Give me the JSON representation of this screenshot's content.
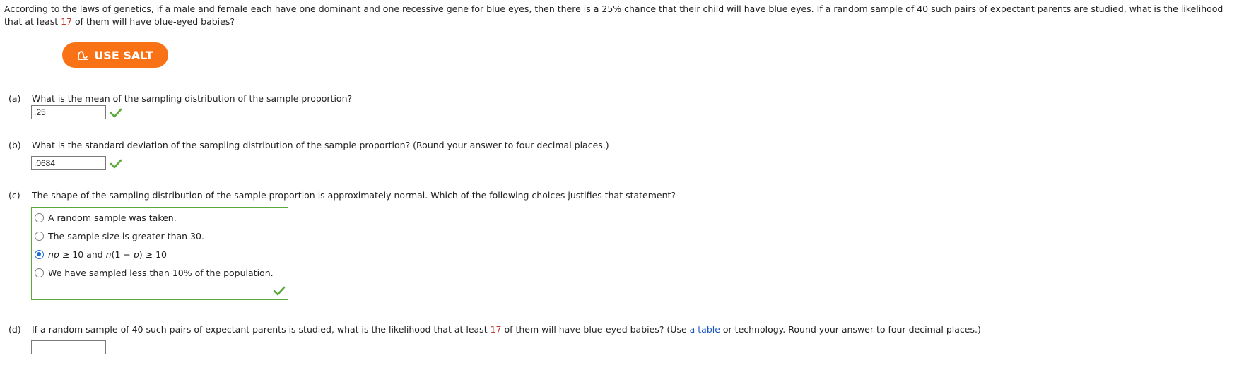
{
  "intro": {
    "text_before": "According to the laws of genetics, if a male and female each have one dominant and one recessive gene for blue eyes, then there is a 25% chance that their child will have blue eyes. If a random sample of 40 such pairs of expectant parents are studied, what is the likelihood that at least ",
    "highlight": "17",
    "text_after": " of them will have blue-eyed babies?"
  },
  "salt_button": {
    "label": "USE SALT"
  },
  "parts": {
    "a": {
      "letter": "(a)",
      "question": "What is the mean of the sampling distribution of the sample proportion?",
      "answer": ".25",
      "status": "correct"
    },
    "b": {
      "letter": "(b)",
      "question": "What is the standard deviation of the sampling distribution of the sample proportion? (Round your answer to four decimal places.)",
      "answer": ".0684",
      "status": "correct"
    },
    "c": {
      "letter": "(c)",
      "question": "The shape of the sampling distribution of the sample proportion is approximately normal. Which of the following choices justifies that statement?",
      "choices": [
        {
          "label": "A random sample was taken.",
          "selected": false
        },
        {
          "label": "The sample size is greater than 30.",
          "selected": false
        },
        {
          "label_parts": [
            "np",
            " ≥ 10 and ",
            "n",
            "(1 − ",
            "p",
            ") ≥ 10"
          ],
          "selected": true
        },
        {
          "label": "We have sampled less than 10% of the population.",
          "selected": false
        }
      ],
      "status": "correct"
    },
    "d": {
      "letter": "(d)",
      "question_before": "If a random sample of 40 such pairs of expectant parents is studied, what is the likelihood that at least ",
      "highlight": "17",
      "question_middle": " of them will have blue-eyed babies? (Use ",
      "link_text": "a table",
      "question_after": " or technology. Round your answer to four decimal places.)",
      "answer": "",
      "status": "unanswered"
    }
  },
  "colors": {
    "accent": "#f97316",
    "correct": "#5aa83a",
    "highlight": "#c0392b",
    "link": "#1a56c4",
    "radio_selected": "#1a6fd6"
  }
}
